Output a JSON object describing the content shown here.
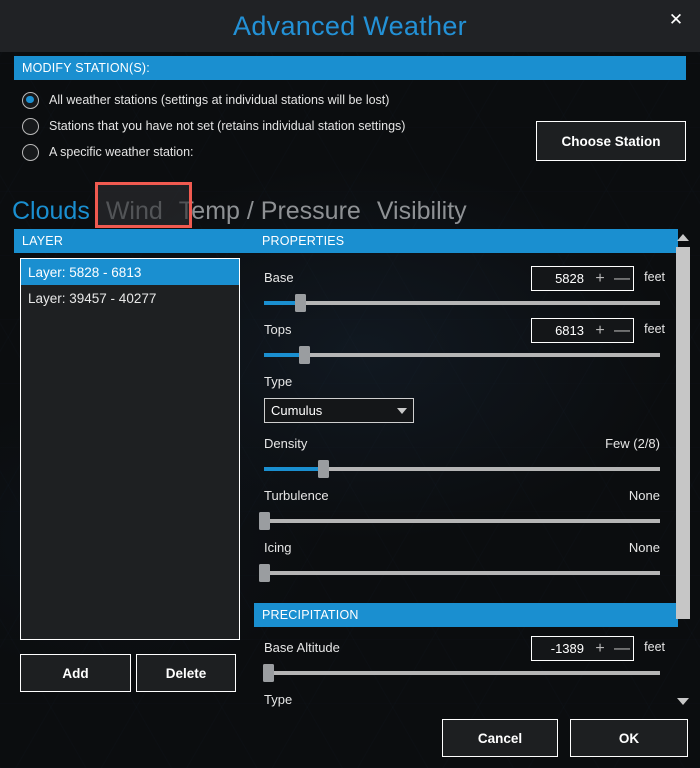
{
  "window": {
    "title": "Advanced Weather",
    "close_icon": "close-icon"
  },
  "modify": {
    "section_label": "MODIFY STATION(S):",
    "options": [
      {
        "label": "All weather stations (settings at individual stations will be lost)",
        "selected": true
      },
      {
        "label": "Stations that you have not set (retains individual station settings)",
        "selected": false
      },
      {
        "label": "A specific weather station:",
        "selected": false
      }
    ],
    "choose_station_label": "Choose Station"
  },
  "tabs": [
    {
      "label": "Clouds",
      "active": true,
      "highlighted": false
    },
    {
      "label": "Wind",
      "active": false,
      "highlighted": true
    },
    {
      "label": "Temp / Pressure",
      "active": false,
      "highlighted": false
    },
    {
      "label": "Visibility",
      "active": false,
      "highlighted": false
    }
  ],
  "layer_panel": {
    "header": "LAYER",
    "items": [
      {
        "label": "Layer: 5828 - 6813",
        "selected": true
      },
      {
        "label": "Layer: 39457 - 40277",
        "selected": false
      }
    ],
    "add_label": "Add",
    "delete_label": "Delete"
  },
  "properties": {
    "header": "PROPERTIES",
    "base": {
      "label": "Base",
      "value": "5828",
      "unit": "feet",
      "slider_percent": 9,
      "plus": "+",
      "minus": "—"
    },
    "tops": {
      "label": "Tops",
      "value": "6813",
      "unit": "feet",
      "slider_percent": 10,
      "plus": "+",
      "minus": "—"
    },
    "type": {
      "label": "Type",
      "value": "Cumulus"
    },
    "density": {
      "label": "Density",
      "value": "Few (2/8)",
      "slider_percent": 15
    },
    "turbulence": {
      "label": "Turbulence",
      "value": "None",
      "slider_percent": 0
    },
    "icing": {
      "label": "Icing",
      "value": "None",
      "slider_percent": 0
    }
  },
  "precipitation": {
    "header": "PRECIPITATION",
    "base_altitude": {
      "label": "Base Altitude",
      "value": "-1389",
      "unit": "feet",
      "slider_percent": 1,
      "plus": "+",
      "minus": "—"
    },
    "type": {
      "label": "Type"
    }
  },
  "scrollbar": {
    "up_icon": "chevron-up-icon",
    "down_icon": "chevron-down-icon"
  },
  "footer": {
    "cancel_label": "Cancel",
    "ok_label": "OK"
  },
  "colors": {
    "accent": "#1a8fd0",
    "highlight_box": "#f05a50",
    "background": "#0b0d0f",
    "titlebar": "#202225"
  }
}
